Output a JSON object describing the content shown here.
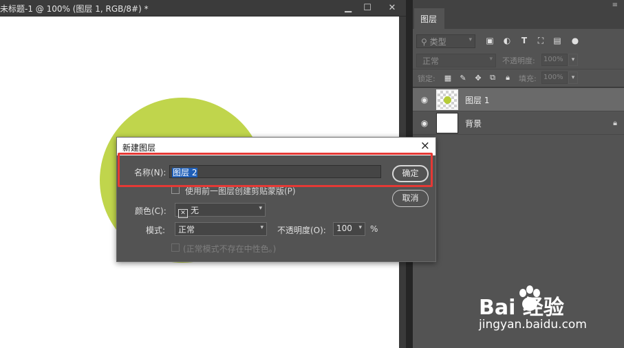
{
  "document": {
    "title": "未标题-1 @ 100% (图层 1, RGB/8#) *",
    "window_buttons": {
      "minimize": "▁",
      "maximize": "☐",
      "close": "✕"
    },
    "circle_color": "#c0d54c"
  },
  "layers_panel": {
    "tab_label": "图层",
    "filter_label": "类型",
    "blend_mode": "正常",
    "opacity_label": "不透明度:",
    "opacity_value": "100%",
    "lock_label": "锁定:",
    "fill_label": "填充:",
    "fill_value": "100%",
    "layers": [
      {
        "name": "图层 1",
        "selected": true,
        "thumbnail": "transparent-with-green-dot"
      },
      {
        "name": "背景",
        "selected": false,
        "thumbnail": "white",
        "locked": true
      }
    ]
  },
  "dialog": {
    "title": "新建图层",
    "name_label": "名称(N):",
    "name_value": "图层 2",
    "clipping_checkbox_label": "使用前一图层创建剪贴蒙版(P)",
    "color_label": "颜色(C):",
    "color_value": "无",
    "mode_label": "模式:",
    "mode_value": "正常",
    "opacity_label": "不透明度(O):",
    "opacity_value": "100",
    "opacity_unit": "%",
    "neutral_checkbox_label": "(正常模式不存在中性色。)",
    "ok_button": "确定",
    "cancel_button": "取消",
    "close_icon": "×"
  },
  "annotation": {
    "highlight_color": "#e53935"
  },
  "watermark": {
    "brand": "Bai  经验",
    "url": "jingyan.baidu.com"
  }
}
